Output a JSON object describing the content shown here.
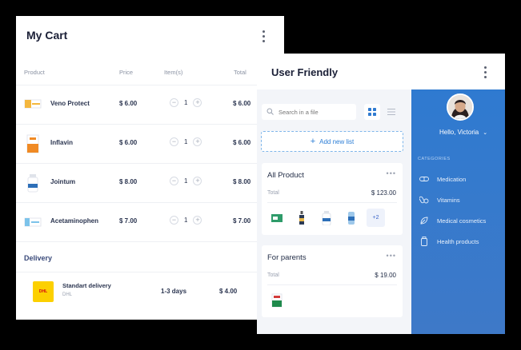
{
  "cart": {
    "title": "My Cart",
    "columns": [
      "Product",
      "Price",
      "Item(s)",
      "Total"
    ],
    "rows": [
      {
        "name": "Veno Protect",
        "price": "$ 6.00",
        "qty": "1",
        "total": "$ 6.00"
      },
      {
        "name": "Inflavin",
        "price": "$ 6.00",
        "qty": "1",
        "total": "$ 6.00"
      },
      {
        "name": "Jointum",
        "price": "$ 8.00",
        "qty": "1",
        "total": "$ 8.00"
      },
      {
        "name": "Acetaminophen",
        "price": "$ 7.00",
        "qty": "1",
        "total": "$ 7.00"
      }
    ],
    "minus": "−",
    "plus": "+",
    "delivery_label": "Delivery",
    "delivery": {
      "name": "Standart delivery",
      "carrier": "DHL",
      "logo_text": "DHL",
      "days": "1-3 days",
      "price": "$ 4.00"
    }
  },
  "uf": {
    "title": "User Friendly",
    "search_placeholder": "Search in a file",
    "add_new_list": "Add new list",
    "add_plus": "+",
    "cards": [
      {
        "title": "All Product",
        "dots": "•••",
        "total_label": "Total",
        "amount": "$ 123.00",
        "more": "+2"
      },
      {
        "title": "For parents",
        "dots": "•••",
        "total_label": "Total",
        "amount": "$ 19.00"
      }
    ],
    "greeting": "Hello, Victoria",
    "greeting_chevron": "⌄",
    "categories_label": "CATEGORIES",
    "categories": [
      "Medication",
      "Vitamins",
      "Medical cosmetics",
      "Health products"
    ]
  },
  "colors": {
    "accent": "#2f7ad0",
    "add_list_text": "#2c7ed6",
    "dhl_yellow": "#fcd000",
    "dhl_red": "#d40511"
  },
  "icons": [
    "kebab-menu-icon",
    "search-icon",
    "grid-view-icon",
    "list-view-icon",
    "chevron-down-icon",
    "capsule-icon",
    "pills-icon",
    "leaf-icon",
    "bottle-icon"
  ]
}
